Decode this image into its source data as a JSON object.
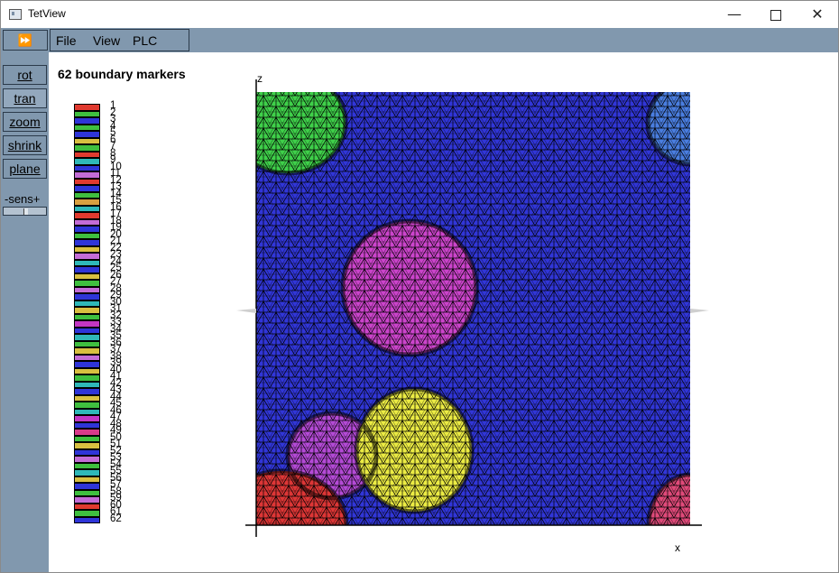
{
  "window": {
    "title": "TetView"
  },
  "window_controls": {
    "minimize": "—",
    "close": "✕"
  },
  "menubar": {
    "fast_forward": "⏩",
    "items": [
      "File",
      "View",
      "PLC"
    ]
  },
  "toolbar": {
    "buttons": [
      {
        "label": "rot",
        "active": false
      },
      {
        "label": "tran",
        "active": true
      },
      {
        "label": "zoom",
        "active": false
      },
      {
        "label": "shrink",
        "active": false
      },
      {
        "label": "plane",
        "active": false
      }
    ],
    "sens_label": "-sens+"
  },
  "view": {
    "heading": "62 boundary markers",
    "axes": {
      "z": "z",
      "x": "x"
    },
    "legend_colors": [
      "#e03a2f",
      "#3fbf3f",
      "#2f35d8",
      "#3fbf3f",
      "#2f35d8",
      "#d8c040",
      "#3fbf3f",
      "#e03a2f",
      "#2fb8b8",
      "#2f35d8",
      "#c36cd6",
      "#e03a2f",
      "#2f35d8",
      "#3fbf3f",
      "#d8a040",
      "#2fb8b8",
      "#e03a2f",
      "#c36cd6",
      "#2f35d8",
      "#3fbf3f",
      "#2f35d8",
      "#d8c040",
      "#c36cd6",
      "#2fb8b8",
      "#2f35d8",
      "#d8c040",
      "#3fbf3f",
      "#c36cd6",
      "#2f35d8",
      "#2fb8b8",
      "#d8c040",
      "#3fbf3f",
      "#c336c3",
      "#2f35d8",
      "#2fb8b8",
      "#3fbf3f",
      "#d8c040",
      "#c36cd6",
      "#2f35d8",
      "#d8c040",
      "#3fbf3f",
      "#2fb8b8",
      "#2f35d8",
      "#d8c040",
      "#3fbf3f",
      "#2fb8b8",
      "#c336c3",
      "#2f35d8",
      "#d83a8a",
      "#3fbf3f",
      "#d8c040",
      "#2f35d8",
      "#c36cd6",
      "#3fbf3f",
      "#2fb8b8",
      "#d8c040",
      "#2f35d8",
      "#3fbf3f",
      "#c36cd6",
      "#e03a2f",
      "#3fbf3f",
      "#2f35d8"
    ],
    "mesh_colors": {
      "background": "#3136d8",
      "top_left": "#3fd04a",
      "top_right": "#4a7ee0",
      "center": "#cc44cc",
      "bottom_left_violet": "#b44ad6",
      "yellow": "#ecec44",
      "bottom_left_red": "#dd3636",
      "bottom_right_pink": "#e04a7a"
    }
  }
}
